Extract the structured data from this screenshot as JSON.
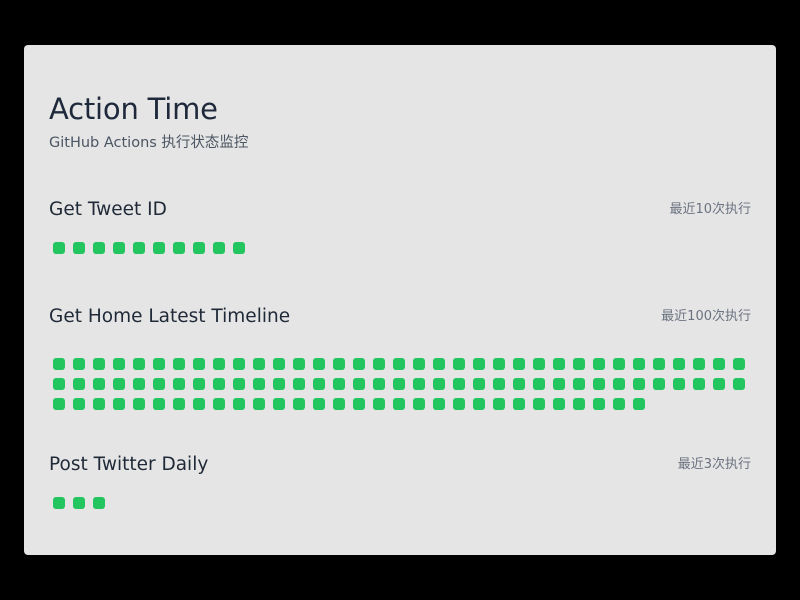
{
  "header": {
    "title": "Action Time",
    "subtitle": "GitHub Actions 执行状态监控"
  },
  "colors": {
    "success": "#22c55e",
    "card_background": "#e5e5e5",
    "page_background": "#000000"
  },
  "workflows": [
    {
      "name": "Get Tweet ID",
      "count_label": "最近10次执行",
      "runs_total": 10,
      "runs_success": 10,
      "runs_failed": 0
    },
    {
      "name": "Get Home Latest Timeline",
      "count_label": "最近100次执行",
      "runs_total": 100,
      "runs_success": 100,
      "runs_failed": 0
    },
    {
      "name": "Post Twitter Daily",
      "count_label": "最近3次执行",
      "runs_total": 3,
      "runs_success": 3,
      "runs_failed": 0
    }
  ]
}
